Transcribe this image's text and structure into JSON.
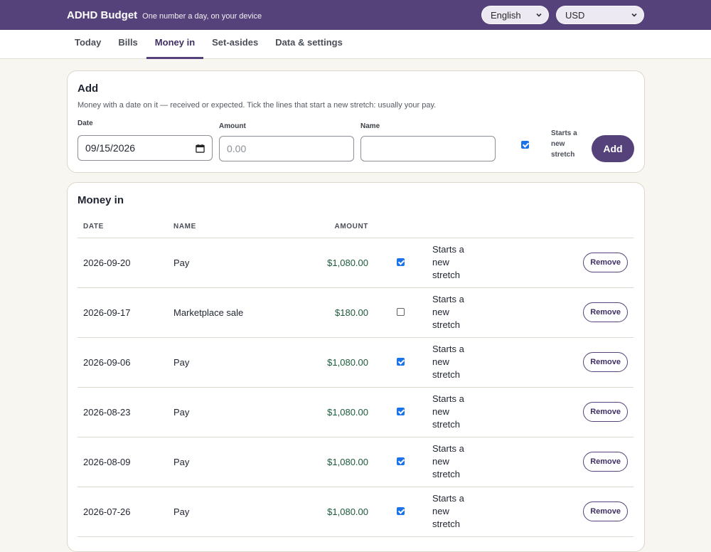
{
  "header": {
    "app_title": "ADHD Budget",
    "tagline": "One number a day, on your device",
    "language": "English",
    "currency": "USD"
  },
  "tabs": [
    {
      "label": "Today"
    },
    {
      "label": "Bills"
    },
    {
      "label": "Money in",
      "active": true
    },
    {
      "label": "Set-asides"
    },
    {
      "label": "Data & settings"
    }
  ],
  "add_form": {
    "title": "Add",
    "hint": "Money with a date on it — received or expected. Tick the lines that start a new stretch: usually your pay.",
    "date_label": "Date",
    "date_value": "09/15/2026",
    "amount_label": "Amount",
    "amount_placeholder": "0.00",
    "name_label": "Name",
    "name_value": "",
    "starts_stretch_checked": true,
    "starts_stretch_label": "Starts a new stretch",
    "add_button": "Add"
  },
  "money_in": {
    "title": "Money in",
    "columns": {
      "date": "DATE",
      "name": "NAME",
      "amount": "AMOUNT"
    },
    "stretch_label": "Starts a new stretch",
    "remove_label": "Remove",
    "rows": [
      {
        "date": "2026-09-20",
        "name": "Pay",
        "amount": "$1,080.00",
        "starts_stretch": true
      },
      {
        "date": "2026-09-17",
        "name": "Marketplace sale",
        "amount": "$180.00",
        "starts_stretch": false
      },
      {
        "date": "2026-09-06",
        "name": "Pay",
        "amount": "$1,080.00",
        "starts_stretch": true
      },
      {
        "date": "2026-08-23",
        "name": "Pay",
        "amount": "$1,080.00",
        "starts_stretch": true
      },
      {
        "date": "2026-08-09",
        "name": "Pay",
        "amount": "$1,080.00",
        "starts_stretch": true
      },
      {
        "date": "2026-07-26",
        "name": "Pay",
        "amount": "$1,080.00",
        "starts_stretch": true
      }
    ]
  },
  "colors": {
    "brand": "#56427a",
    "amount_green": "#1c5a3a",
    "checkbox_blue": "#1a73e8",
    "page_bg": "#f8f6f0"
  }
}
